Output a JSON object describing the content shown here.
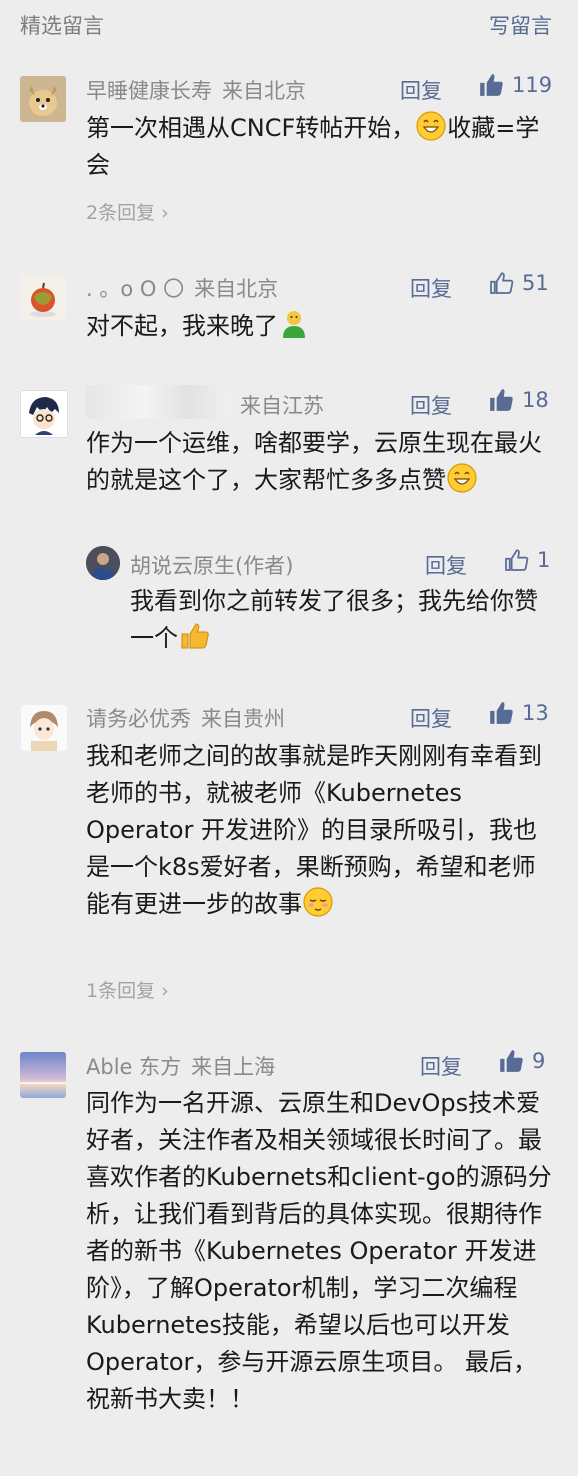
{
  "header": {
    "title": "精选留言",
    "write": "写留言"
  },
  "comments": [
    {
      "name": "早睡健康长寿",
      "location": "来自北京",
      "reply": "回复",
      "likes": "119",
      "liked": true,
      "text": "第一次相遇从CNCF转帖开始，",
      "text2": "收藏=学会",
      "more": "2条回复"
    },
    {
      "name": ". 。o O 〇",
      "location": "来自北京",
      "reply": "回复",
      "likes": "51",
      "liked": false,
      "text": "对不起，我来晚了"
    },
    {
      "name": "",
      "location": "来自江苏",
      "reply": "回复",
      "likes": "18",
      "liked": true,
      "text": "作为一个运维，啥都要学，云原生现在最火的就是这个了，大家帮忙多多点赞",
      "subreply": {
        "name": "胡说云原生(作者)",
        "reply": "回复",
        "likes": "1",
        "text": "我看到你之前转发了很多；我先给你赞一个"
      }
    },
    {
      "name": "请务必优秀",
      "location": "来自贵州",
      "reply": "回复",
      "likes": "13",
      "liked": true,
      "text": "我和老师之间的故事就是昨天刚刚有幸看到老师的书，就被老师《Kubernetes Operator 开发进阶》的目录所吸引，我也是一个k8s爱好者，果断预购，希望和老师能有更进一步的故事",
      "more": "1条回复"
    },
    {
      "name": "Able 东方",
      "location": "来自上海",
      "reply": "回复",
      "likes": "9",
      "liked": true,
      "text": "同作为一名开源、云原生和DevOps技术爱好者，关注作者及相关领域很长时间了。最喜欢作者的Kubernets和client-go的源码分析，让我们看到背后的具体实现。很期待作者的新书《Kubernetes Operator 开发进阶》，了解Operator机制，学习二次编程Kubernetes技能，希望以后也可以开发Operator，参与开源云原生项目。 最后，祝新书大卖！！"
    }
  ]
}
